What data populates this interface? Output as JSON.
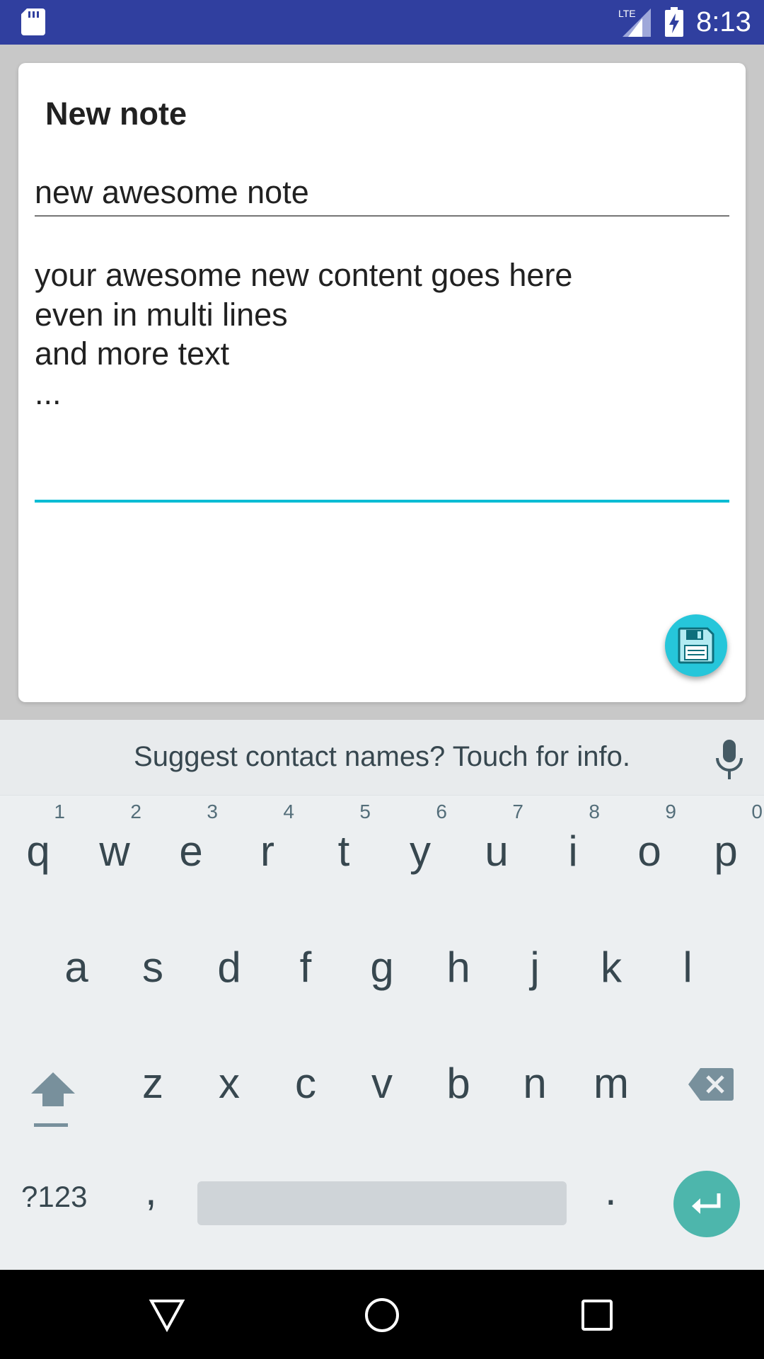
{
  "status_bar": {
    "time": "8:13",
    "network_label": "LTE",
    "icons": [
      "sd-card-icon",
      "lte-signal-icon",
      "battery-charging-icon"
    ]
  },
  "dialog": {
    "title": "New note",
    "title_field_value": "new awesome note",
    "content_lines": [
      "your awesome new content goes here",
      "even in multi lines",
      "and more text",
      "..."
    ],
    "save_icon": "floppy-disk-icon"
  },
  "keyboard": {
    "suggestion": "Suggest contact names? Touch for info.",
    "row1": [
      {
        "letter": "q",
        "hint": "1"
      },
      {
        "letter": "w",
        "hint": "2"
      },
      {
        "letter": "e",
        "hint": "3"
      },
      {
        "letter": "r",
        "hint": "4"
      },
      {
        "letter": "t",
        "hint": "5"
      },
      {
        "letter": "y",
        "hint": "6"
      },
      {
        "letter": "u",
        "hint": "7"
      },
      {
        "letter": "i",
        "hint": "8"
      },
      {
        "letter": "o",
        "hint": "9"
      },
      {
        "letter": "p",
        "hint": "0"
      }
    ],
    "row2": [
      "a",
      "s",
      "d",
      "f",
      "g",
      "h",
      "j",
      "k",
      "l"
    ],
    "row3": [
      "z",
      "x",
      "c",
      "v",
      "b",
      "n",
      "m"
    ],
    "symbols_label": "?123",
    "comma_label": ",",
    "period_label": ".",
    "accent_color": "#4db6ac"
  },
  "colors": {
    "status_bar": "#303f9f",
    "focus_underline": "#00bcd4",
    "fab": "#26c6da"
  }
}
